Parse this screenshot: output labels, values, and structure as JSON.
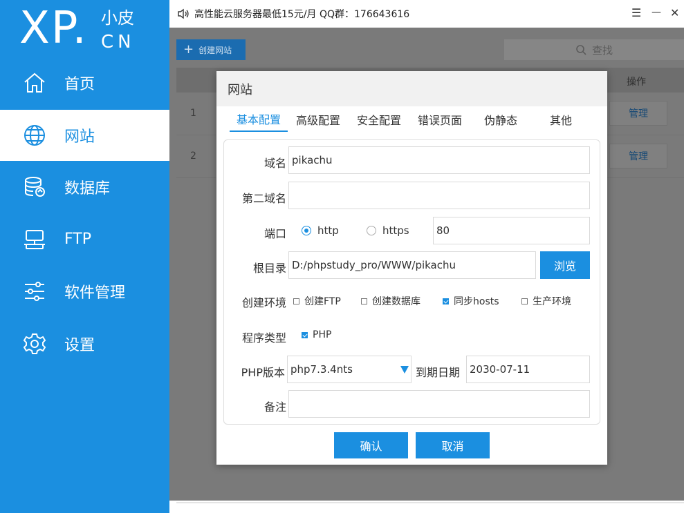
{
  "logo": {
    "main": "XP",
    "dot": ".",
    "small": "小皮",
    "cn": "CN"
  },
  "sidebar": {
    "items": [
      {
        "label": "首页",
        "icon": "home-icon"
      },
      {
        "label": "网站",
        "icon": "globe-icon",
        "active": true
      },
      {
        "label": "数据库",
        "icon": "database-icon"
      },
      {
        "label": "FTP",
        "icon": "ftp-icon"
      },
      {
        "label": "软件管理",
        "icon": "sliders-icon"
      },
      {
        "label": "设置",
        "icon": "gear-icon"
      }
    ]
  },
  "topbar": {
    "notice": "高性能云服务器最低15元/月  QQ群：176643616",
    "menu_icon": "☰",
    "minimize_icon": "—",
    "close_icon": "✕"
  },
  "toolbar": {
    "create_label": "创建网站",
    "search_placeholder": "查找"
  },
  "table": {
    "op_header": "操作",
    "rows": [
      {
        "num": "1",
        "action": "管理"
      },
      {
        "num": "2",
        "action": "管理"
      }
    ]
  },
  "modal": {
    "title": "网站",
    "tabs": [
      "基本配置",
      "高级配置",
      "安全配置",
      "错误页面",
      "伪静态",
      "其他"
    ],
    "active_tab": 0,
    "form": {
      "domain_label": "域名",
      "domain_value": "pikachu",
      "second_domain_label": "第二域名",
      "second_domain_value": "",
      "port_label": "端口",
      "http_label": "http",
      "https_label": "https",
      "protocol_selected": "http",
      "port_value": "80",
      "root_label": "根目录",
      "root_value": "D:/phpstudy_pro/WWW/pikachu",
      "browse_label": "浏览",
      "env_label": "创建环境",
      "env_options": [
        {
          "label": "创建FTP",
          "checked": false
        },
        {
          "label": "创建数据库",
          "checked": false
        },
        {
          "label": "同步hosts",
          "checked": true
        },
        {
          "label": "生产环境",
          "checked": false
        }
      ],
      "program_label": "程序类型",
      "program_option": {
        "label": "PHP",
        "checked": true
      },
      "php_version_label": "PHP版本",
      "php_version_value": "php7.3.4nts",
      "expire_label": "到期日期",
      "expire_value": "2030-07-11",
      "note_label": "备注",
      "note_value": ""
    },
    "confirm_label": "确认",
    "cancel_label": "取消"
  },
  "colors": {
    "accent": "#1b8fe0",
    "sidebar_bg": "#1b8fe0",
    "overlay": "#7a7a7a"
  }
}
